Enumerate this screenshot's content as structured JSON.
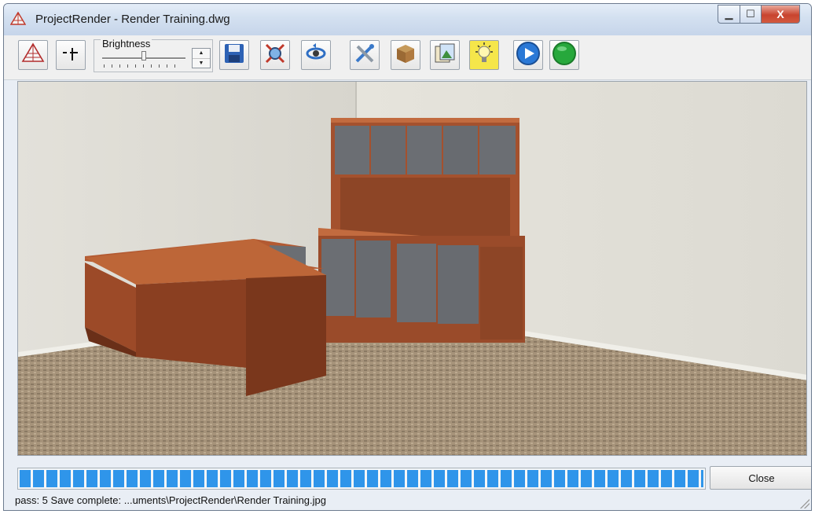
{
  "window": {
    "title": "ProjectRender - Render Training.dwg",
    "controls": {
      "minimize": "▁",
      "maximize": "☐",
      "close": "X"
    }
  },
  "toolbar": {
    "buttons": [
      {
        "icon": "render-pyramid-icon"
      },
      {
        "icon": "crosshair-icon"
      },
      {
        "icon": "save-disk-icon"
      },
      {
        "icon": "zoom-fit-icon"
      },
      {
        "icon": "orbit-icon"
      },
      {
        "icon": "tools-icon"
      },
      {
        "icon": "material-box-icon"
      },
      {
        "icon": "background-image-icon"
      },
      {
        "icon": "lightbulb-icon"
      },
      {
        "icon": "play-icon"
      },
      {
        "icon": "green-light-icon"
      }
    ],
    "brightness": {
      "label": "Brightness",
      "level": 0.5
    }
  },
  "progress": {
    "percent": 100
  },
  "close_button": {
    "label": "Close"
  },
  "status": {
    "text": "pass: 5 Save complete: ...uments\\ProjectRender\\Render Training.jpg"
  },
  "colors": {
    "progress": "#2f95ea",
    "wood": "#a8502e",
    "door_gray": "#6b6e73",
    "carpet": "#a6937a"
  }
}
